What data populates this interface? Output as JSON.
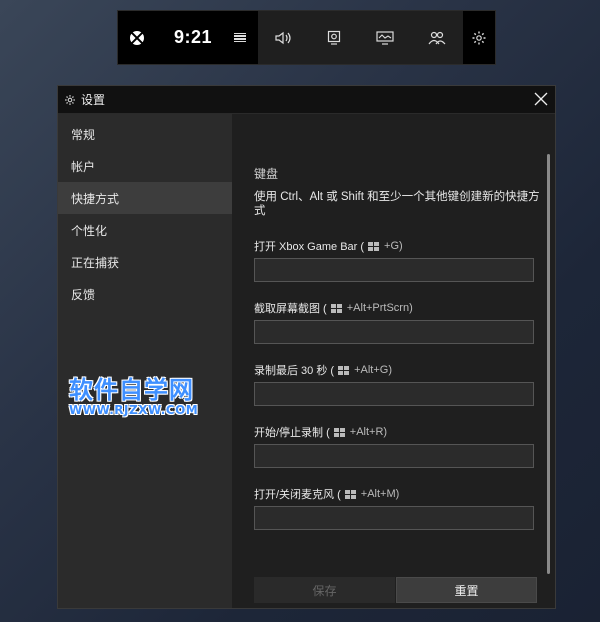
{
  "gamebar": {
    "time": "9:21",
    "widgets": [
      "xbox-icon",
      "menu-icon",
      "audio-icon",
      "capture-icon",
      "performance-icon",
      "social-icon",
      "settings-gear-icon"
    ]
  },
  "settings": {
    "title": "设置",
    "nav": [
      {
        "label": "常规"
      },
      {
        "label": "帐户"
      },
      {
        "label": "快捷方式"
      },
      {
        "label": "个性化"
      },
      {
        "label": "正在捕获"
      },
      {
        "label": "反馈"
      }
    ],
    "active_nav": "快捷方式",
    "section_title": "键盘",
    "description": "使用 Ctrl、Alt 或 Shift 和至少一个其他键创建新的快捷方式",
    "fields": [
      {
        "label": "打开 Xbox Game Bar (",
        "key": "+G)",
        "value": ""
      },
      {
        "label": "截取屏幕截图 (",
        "key": "+Alt+PrtScrn)",
        "value": ""
      },
      {
        "label": "录制最后 30 秒 (",
        "key": "+Alt+G)",
        "value": ""
      },
      {
        "label": "开始/停止录制 (",
        "key": "+Alt+R)",
        "value": ""
      },
      {
        "label": "打开/关闭麦克风 (",
        "key": "+Alt+M)",
        "value": ""
      }
    ],
    "buttons": {
      "save": "保存",
      "reset": "重置"
    }
  },
  "watermark": {
    "title": "软件自学网",
    "url": "WWW.RJZXW.COM"
  },
  "colors": {
    "accent": "#3e8fff",
    "panel": "#1f1f1f",
    "sidebar": "#2b2b2b"
  }
}
